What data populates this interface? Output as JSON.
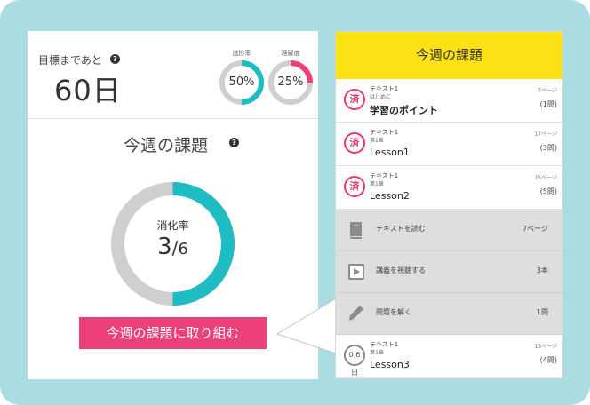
{
  "summary": {
    "goal_label": "目標まであと",
    "days_remaining": "60日",
    "progress_ring": {
      "caption": "進捗率",
      "value_text": "50%",
      "value": 50,
      "color": "#1fbcc4"
    },
    "comprehension_ring": {
      "caption": "理解度",
      "value_text": "25%",
      "value": 25,
      "color": "#ed3f78"
    }
  },
  "weekly": {
    "title": "今週の課題",
    "completion_label": "消化率",
    "completed": 3,
    "total": 6,
    "completed_text": "3",
    "slash_text": "/",
    "total_text": "6",
    "cta_label": "今週の課題に取り組む",
    "ring_color": "#1fbcc4",
    "ring_track_color": "#cfcfcf"
  },
  "panel": {
    "header": "今週の課題",
    "tasks": [
      {
        "badge": "済",
        "done": true,
        "title": "テキスト1",
        "chapter": "はじめに",
        "name": "学習のポイント",
        "pages": "7ページ",
        "questions": "(1問)"
      },
      {
        "badge": "済",
        "done": true,
        "title": "テキスト1",
        "chapter": "第1章",
        "name": "Lesson1",
        "pages": "17ページ",
        "questions": "(3問)"
      },
      {
        "badge": "済",
        "done": true,
        "title": "テキスト1",
        "chapter": "第1章",
        "name": "Lesson2",
        "pages": "15ページ",
        "questions": "(5問)"
      }
    ],
    "actions": [
      {
        "icon": "book-icon",
        "label": "テキストを読む",
        "count": "7ページ"
      },
      {
        "icon": "play-icon",
        "label": "講義を視聴する",
        "count": "3本"
      },
      {
        "icon": "pencil-icon",
        "label": "問題を解く",
        "count": "1問"
      }
    ],
    "next_task": {
      "badge": "0.6日",
      "done": false,
      "title": "テキスト1",
      "chapter": "第1章",
      "name": "Lesson3",
      "pages": "13ページ",
      "questions": "(4問)"
    }
  },
  "icons": {
    "help": "?",
    "accent_pink": "#ed3f78",
    "accent_yellow": "#fce115",
    "frame_color": "#a9dde1"
  }
}
